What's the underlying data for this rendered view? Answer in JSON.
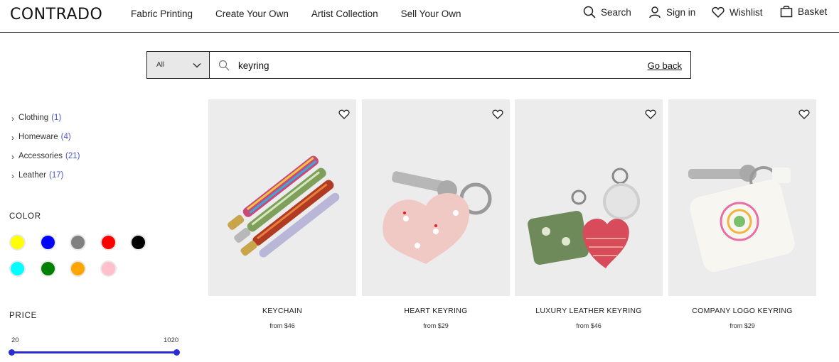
{
  "header": {
    "logo": "CONTRADO",
    "nav": [
      "Fabric Printing",
      "Create Your Own",
      "Artist Collection",
      "Sell Your Own"
    ],
    "search_label": "Search",
    "signin_label": "Sign in",
    "wishlist_label": "Wishlist",
    "basket_label": "Basket"
  },
  "search": {
    "scope_value": "All",
    "query": "keyring",
    "go_back_label": "Go back"
  },
  "categories": [
    {
      "label": "Clothing",
      "count": "(1)"
    },
    {
      "label": "Homeware",
      "count": "(4)"
    },
    {
      "label": "Accessories",
      "count": "(21)"
    },
    {
      "label": "Leather",
      "count": "(17)"
    }
  ],
  "filters": {
    "color_title": "COLOR",
    "colors": [
      "#ffff00",
      "#0000ff",
      "#808080",
      "#ff0000",
      "#000000",
      "#00ffff",
      "#008000",
      "#ffa500",
      "#ffc0cb"
    ],
    "price_title": "PRICE",
    "price_min": "20",
    "price_max": "1020"
  },
  "products": [
    {
      "name": "KEYCHAIN",
      "price": "from $46",
      "image_icon": "keychain-straps-image"
    },
    {
      "name": "HEART KEYRING",
      "price": "from $29",
      "image_icon": "heart-keyring-image"
    },
    {
      "name": "LUXURY LEATHER KEYRING",
      "price": "from $46",
      "image_icon": "luxury-keyring-image"
    },
    {
      "name": "COMPANY LOGO KEYRING",
      "price": "from $29",
      "image_icon": "logo-keyring-image"
    }
  ]
}
